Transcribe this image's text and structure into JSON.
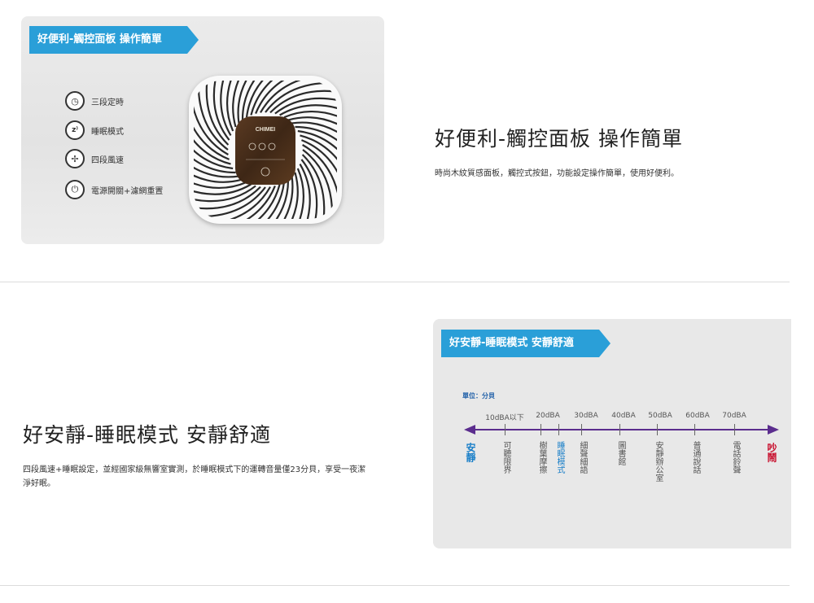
{
  "panel1": {
    "banner": "好便利-觸控面板 操作簡單",
    "features": [
      {
        "icon": "timer-icon",
        "glyph": "◷",
        "label": "三段定時"
      },
      {
        "icon": "sleep-icon",
        "glyph": "ᶻᶻ",
        "label": "睡眠模式"
      },
      {
        "icon": "fan-icon",
        "glyph": "✢",
        "label": "四段風速"
      },
      {
        "icon": "power-icon",
        "glyph": "⏻",
        "label": "電源開關+濾網重置"
      }
    ],
    "device_brand": "CHIMEI",
    "title": "好便利-觸控面板 操作簡單",
    "desc": "時尚木紋質感面板，觸控式按鈕，功能設定操作簡單，使用好便利。"
  },
  "panel2": {
    "banner": "好安靜-睡眠模式 安靜舒適",
    "title": "好安靜-睡眠模式 安靜舒適",
    "desc": "四段風速+睡眠設定，並經國家級無響室實測，於睡眠模式下的運轉音量僅23分貝，享受一夜潔淨好眠。",
    "unit": "單位：分貝",
    "db_labels": [
      "10dBA以下",
      "20dBA",
      "30dBA",
      "40dBA",
      "50dBA",
      "60dBA",
      "70dBA"
    ],
    "left_end": "安靜",
    "right_end": "吵鬧",
    "sounds": [
      "可聽限界",
      "樹葉摩擦",
      "睡眠模式",
      "細聲細語",
      "圖書館",
      "安靜辦公室",
      "普通說話",
      "電話鈴聲"
    ],
    "colors": {
      "axis": "#5b2d8e",
      "quiet": "#1a7fc8",
      "loud": "#c8102e",
      "banner": "#2a9fd8"
    }
  }
}
